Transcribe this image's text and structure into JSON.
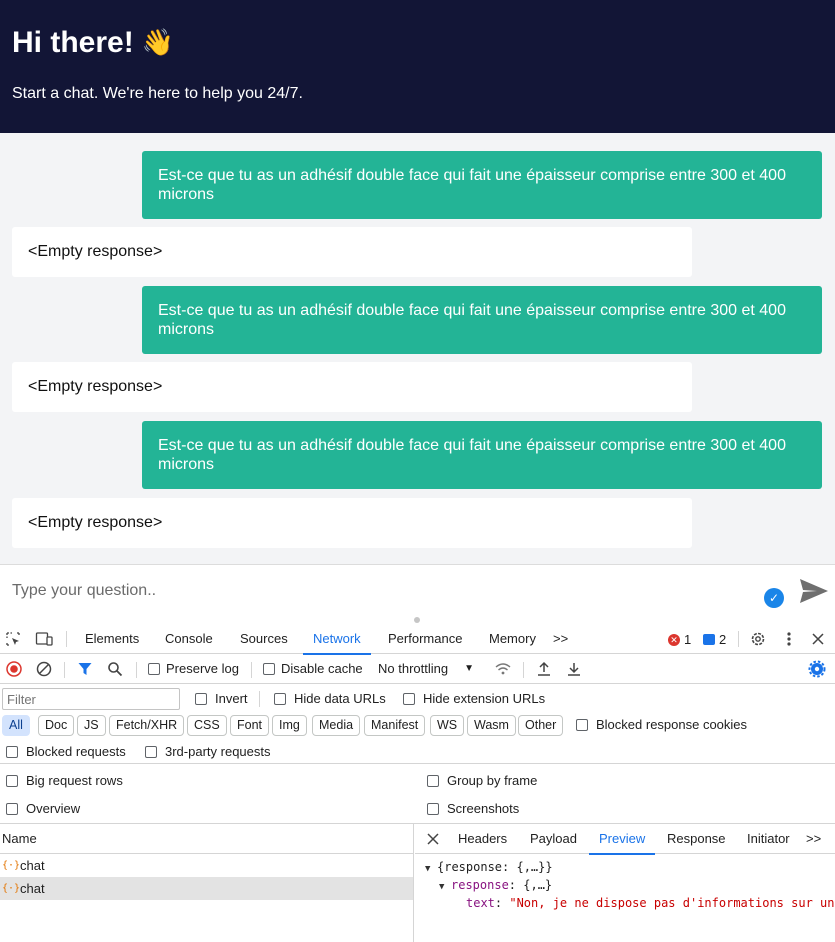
{
  "header": {
    "title": "Hi there!",
    "emoji": "👋",
    "subtitle": "Start a chat. We're here to help you 24/7."
  },
  "messages": [
    {
      "role": "user",
      "text": "Est-ce que tu as un adhésif double face qui fait une épaisseur comprise entre 300 et 400 microns"
    },
    {
      "role": "bot",
      "text": "<Empty response>"
    },
    {
      "role": "user",
      "text": "Est-ce que tu as un adhésif double face qui fait une épaisseur comprise entre 300 et 400 microns"
    },
    {
      "role": "bot",
      "text": "<Empty response>"
    },
    {
      "role": "user",
      "text": "Est-ce que tu as un adhésif double face qui fait une épaisseur comprise entre 300 et 400 microns"
    },
    {
      "role": "bot",
      "text": "<Empty response>"
    }
  ],
  "input": {
    "placeholder": "Type your question.."
  },
  "devtools": {
    "tabs": [
      "Elements",
      "Console",
      "Sources",
      "Network",
      "Performance",
      "Memory"
    ],
    "active_tab": "Network",
    "more_tabs": ">>",
    "error_count": "1",
    "message_count": "2",
    "toolbar": {
      "preserve_log": "Preserve log",
      "disable_cache": "Disable cache",
      "throttling": "No throttling"
    },
    "filter": {
      "placeholder": "Filter",
      "invert": "Invert",
      "hide_data_urls": "Hide data URLs",
      "hide_extension_urls": "Hide extension URLs"
    },
    "type_filters": [
      "All",
      "Doc",
      "JS",
      "Fetch/XHR",
      "CSS",
      "Font",
      "Img",
      "Media",
      "Manifest",
      "WS",
      "Wasm",
      "Other"
    ],
    "active_type": "All",
    "blocked_response_cookies": "Blocked response cookies",
    "blocked_requests": "Blocked requests",
    "third_party_requests": "3rd-party requests",
    "options": {
      "big_request_rows": "Big request rows",
      "group_by_frame": "Group by frame",
      "overview": "Overview",
      "screenshots": "Screenshots"
    },
    "requests_header": "Name",
    "requests": [
      "chat",
      "chat"
    ],
    "detail_tabs": [
      "Headers",
      "Payload",
      "Preview",
      "Response",
      "Initiator"
    ],
    "active_detail_tab": "Preview",
    "preview": {
      "line1": "{response: {,…}}",
      "line2_key": "response",
      "line2_val": "{,…}",
      "line3_key": "text",
      "line3_val": "\"Non, je ne dispose pas d'informations sur un"
    }
  },
  "colors": {
    "header_bg": "#121536",
    "user_bubble": "#23b496",
    "accent_blue": "#1a73e8"
  }
}
